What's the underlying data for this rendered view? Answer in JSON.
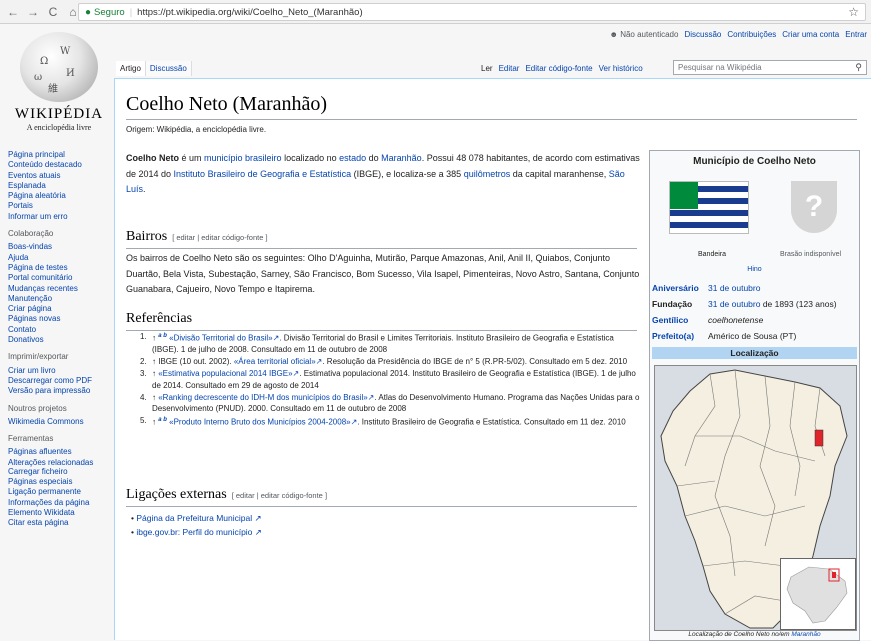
{
  "browser": {
    "back_glyph": "←",
    "forward_glyph": "→",
    "reload_glyph": "C",
    "home_glyph": "⌂",
    "lock_glyph": "🔒",
    "secure_label": "Seguro",
    "separator": "|",
    "url": "https://pt.wikipedia.org/wiki/Coelho_Neto_(Maranhão)",
    "star_glyph": "☆"
  },
  "personal": {
    "not_logged": "Não autenticado",
    "items": [
      "Discussão",
      "Contribuições",
      "Criar uma conta",
      "Entrar"
    ]
  },
  "logo": {
    "wordmark": "WIKIPÉDIA",
    "tagline": "A enciclopédia livre",
    "glyphs": [
      "Ω",
      "W",
      "И",
      "維",
      "ω"
    ]
  },
  "sidebar": {
    "main": [
      "Página principal",
      "Conteúdo destacado",
      "Eventos atuais",
      "Esplanada",
      "Página aleatória",
      "Portais",
      "Informar um erro"
    ],
    "collab_head": "Colaboração",
    "collab": [
      "Boas-vindas",
      "Ajuda",
      "Página de testes",
      "Portal comunitário",
      "Mudanças recentes",
      "Manutenção",
      "Criar página",
      "Páginas novas",
      "Contato",
      "Donativos"
    ],
    "print_head": "Imprimir/exportar",
    "print": [
      "Criar um livro",
      "Descarregar como PDF",
      "Versão para impressão"
    ],
    "projects_head": "Noutros projetos",
    "projects": [
      "Wikimedia Commons"
    ],
    "tools_head": "Ferramentas",
    "tools": [
      "Páginas afluentes",
      "Alterações relacionadas",
      "Carregar ficheiro",
      "Páginas especiais",
      "Ligação permanente",
      "Informações da página",
      "Elemento Wikidata",
      "Citar esta página"
    ]
  },
  "tabs": {
    "left": [
      "Artigo",
      "Discussão"
    ],
    "right": [
      "Ler",
      "Editar",
      "Editar código-fonte",
      "Ver histórico"
    ],
    "search_placeholder": "Pesquisar na Wikipédia",
    "search_icon": "⚲"
  },
  "article": {
    "title": "Coelho Neto (Maranhão)",
    "tagline": "Origem: Wikipédia, a enciclopédia livre.",
    "intro": {
      "bold": "Coelho Neto",
      "t1": " é um ",
      "l1": "município brasileiro",
      "t2": " localizado no ",
      "l2": "estado",
      "t3": " do ",
      "l3": "Maranhão",
      "t4": ". Possui 48 078 habitantes, de acordo com estimativas de 2014 do ",
      "l4": "Instituto Brasileiro de Geografia e Estatística",
      "t5": " (IBGE), e localiza-se a 385 ",
      "l5": "quilômetros",
      "t6": " da capital maranhense, ",
      "l6": "São Luís",
      "t7": "."
    },
    "bairros_title": "Bairros",
    "edit_links": "[ editar | editar código-fonte ]",
    "bairros_text": "Os bairros de Coelho Neto são os seguintes: Olho D'Aguinha, Mutirão, Parque Amazonas, Anil, Anil II, Quiabos, Conjunto Duartão, Bela Vista, Subestação, Sarney, São Francisco, Bom Sucesso, Vila Isapel, Pimenteiras, Novo Astro, Santana, Conjunto Guanabara, Cajueiro, Novo Tempo e Itapirema.",
    "refs_title": "Referências",
    "refs": [
      {
        "num": "1.",
        "pre": "↑ ",
        "sup": "a b",
        "link": "«Divisão Territorial do Brasil»",
        "text": ". Divisão Territorial do Brasil e Limites Territoriais. Instituto Brasileiro de Geografia e Estatística (IBGE). 1 de julho de 2008. Consultado em 11 de outubro de 2008"
      },
      {
        "num": "2.",
        "pre": "↑ IBGE (10 out. 2002). ",
        "sup": "",
        "link": "«Área territorial oficial»",
        "text": ". Resolução da Presidência do IBGE de n° 5 (R.PR-5/02). Consultado em 5 dez. 2010"
      },
      {
        "num": "3.",
        "pre": "↑ ",
        "sup": "",
        "link": "«Estimativa populacional 2014 IBGE»",
        "text": ". Estimativa populacional 2014. Instituto Brasileiro de Geografia e Estatística (IBGE). 1 de julho de 2014. Consultado em 29 de agosto de 2014"
      },
      {
        "num": "4.",
        "pre": "↑ ",
        "sup": "",
        "link": "«Ranking decrescente do IDH-M dos municípios do Brasil»",
        "text": ". Atlas do Desenvolvimento Humano. Programa das Nações Unidas para o Desenvolvimento (PNUD). 2000. Consultado em 11 de outubro de 2008"
      },
      {
        "num": "5.",
        "pre": "↑ ",
        "sup": "a b",
        "link": "«Produto Interno Bruto dos Municípios 2004-2008»",
        "text": ". Instituto Brasileiro de Geografia e Estatística. Consultado em 11 dez. 2010"
      }
    ],
    "links_title": "Ligações externas",
    "links": [
      "Página da Prefeitura Municipal",
      "ibge.gov.br: Perfil do município"
    ]
  },
  "infobox": {
    "title": "Município de Coelho Neto",
    "flag_caption": "Bandeira",
    "coat_caption": "Brasão indisponível",
    "coat_glyph": "?",
    "hino": "Hino",
    "rows": [
      {
        "k": "Aniversário",
        "v": "31 de outubro",
        "v2": ""
      },
      {
        "k": "Fundação",
        "v": "31 de outubro",
        "v2": " de 1893 (123 anos)",
        "v3": "1893"
      },
      {
        "k": "Gentílico",
        "v": "coelhonetense",
        "v2": ""
      },
      {
        "k": "Prefeito(a)",
        "v": "Américo de Sousa (PT)",
        "v2": ""
      }
    ],
    "loc_title": "Localização",
    "map_caption_pre": "Localização de Coelho Neto no/em ",
    "map_caption_link": "Maranhão"
  },
  "colors": {
    "link": "#0645ad",
    "infobox_header": "#b0d4f1",
    "flag_blue": "#1a3c8f",
    "flag_green": "#008a3c",
    "highlight": "#e0242b"
  }
}
